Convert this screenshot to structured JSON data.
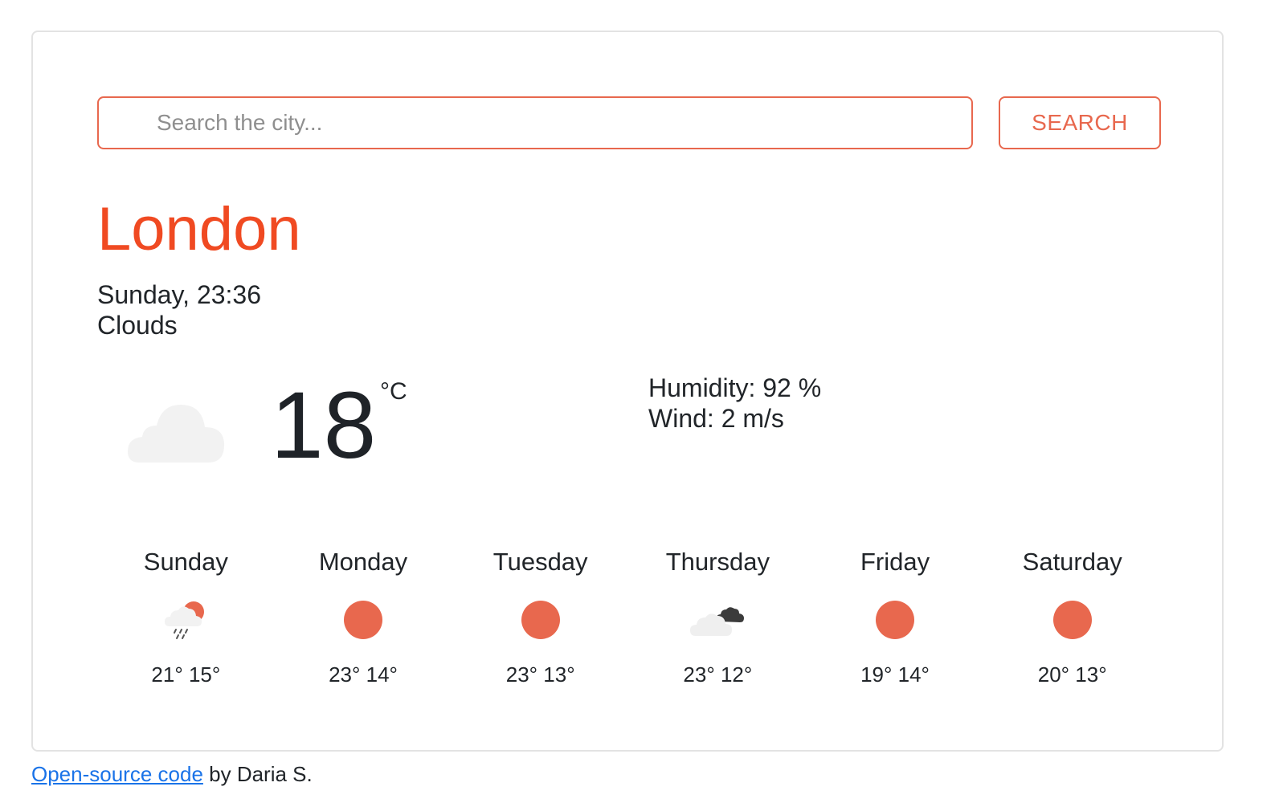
{
  "search": {
    "placeholder": "Search the city...",
    "value": "",
    "button_label": "SEARCH"
  },
  "current": {
    "city": "London",
    "datetime": "Sunday, 23:36",
    "description": "Clouds",
    "temperature": "18",
    "unit": "°C",
    "icon": "cloud-icon",
    "humidity": "Humidity: 92 %",
    "wind": "Wind: 2 m/s"
  },
  "forecast": [
    {
      "day": "Sunday",
      "icon": "rain-sun-icon",
      "temps": "21° 15°"
    },
    {
      "day": "Monday",
      "icon": "sun-icon",
      "temps": "23° 14°"
    },
    {
      "day": "Tuesday",
      "icon": "sun-icon",
      "temps": "23° 13°"
    },
    {
      "day": "Thursday",
      "icon": "dark-clouds-icon",
      "temps": "23° 12°"
    },
    {
      "day": "Friday",
      "icon": "sun-icon",
      "temps": "19° 14°"
    },
    {
      "day": "Saturday",
      "icon": "sun-icon",
      "temps": "20° 13°"
    }
  ],
  "footer": {
    "link_label": "Open-source code",
    "suffix": " by Daria S."
  },
  "colors": {
    "accent": "#e8684e",
    "city": "#f04a22",
    "sun": "#e8684e",
    "link": "#1a73e8"
  }
}
